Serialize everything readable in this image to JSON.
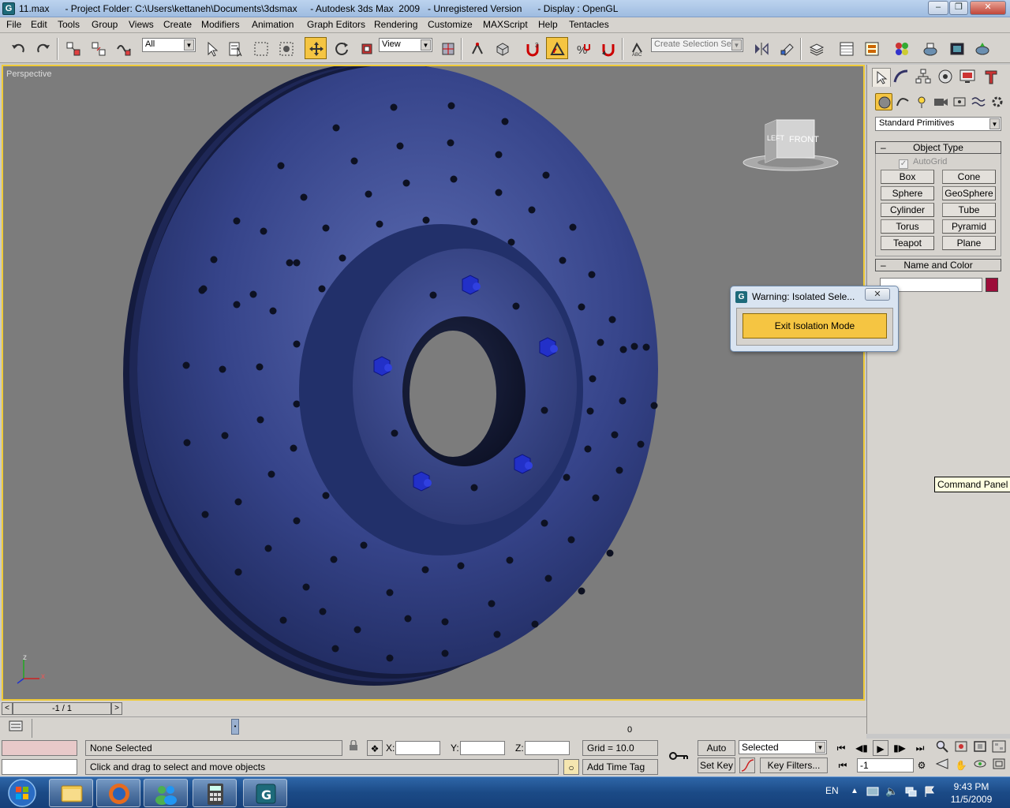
{
  "window": {
    "title": "11.max      - Project Folder: C:\\Users\\kettaneh\\Documents\\3dsmax     - Autodesk 3ds Max  2009   - Unregistered Version      - Display : OpenGL",
    "app_icon": "G"
  },
  "menu": [
    "File",
    "Edit",
    "Tools",
    "Group",
    "Views",
    "Create",
    "Modifiers",
    "Animation",
    "Graph Editors",
    "Rendering",
    "Customize",
    "MAXScript",
    "Help",
    "Tentacles"
  ],
  "toolbar": {
    "selection_filter": "All",
    "reference_coord": "View",
    "named_selection_placeholder": "Create Selection Set"
  },
  "viewport": {
    "label": "Perspective",
    "viewcube_left": "LEFT",
    "viewcube_front": "FRONT",
    "axis_z": "z",
    "axis_x": "x",
    "model_color": "#2e3c78"
  },
  "command_panel": {
    "category": "Standard Primitives",
    "object_type_title": "Object Type",
    "autogrid_label": "AutoGrid",
    "primitives": [
      "Box",
      "Cone",
      "Sphere",
      "GeoSphere",
      "Cylinder",
      "Tube",
      "Torus",
      "Pyramid",
      "Teapot",
      "Plane"
    ],
    "name_color_title": "Name and Color",
    "object_color": "#9d0d3a",
    "tooltip": "Command Panel"
  },
  "dialog": {
    "title": "Warning: Isolated Sele...",
    "button": "Exit Isolation Mode"
  },
  "timeline": {
    "frame_counter": "-1 / 1",
    "tick_label": "0"
  },
  "status": {
    "selection": "None Selected",
    "prompt": "Click and drag to select and move objects",
    "x_label": "X:",
    "y_label": "Y:",
    "z_label": "Z:",
    "grid": "Grid = 10.0",
    "add_time_tag": "Add Time Tag",
    "auto_key": "Auto Key",
    "set_key": "Set Key",
    "key_mode": "Selected",
    "key_filters": "Key Filters...",
    "current_frame": "-1"
  },
  "taskbar": {
    "language": "EN",
    "time": "9:43 PM",
    "date": "11/5/2009"
  }
}
